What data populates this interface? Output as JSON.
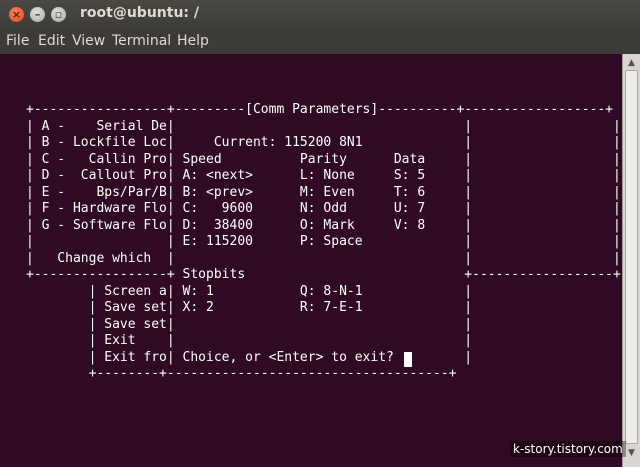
{
  "window": {
    "title": "root@ubuntu: /"
  },
  "menu": [
    "File",
    "Edit",
    "View",
    "Terminal",
    "Help"
  ],
  "terminal_lines": [
    "+-----------------+---------[Comm Parameters]----------+------------------+",
    "| A -    Serial De|                                     |                  |",
    "| B - Lockfile Loc|     Current: 115200 8N1             |                  |",
    "| C -   Callin Pro| Speed          Parity      Data     |                  |",
    "| D -  Callout Pro| A: <next>      L: None     S: 5     |                  |",
    "| E -    Bps/Par/B| B: <prev>      M: Even     T: 6     |                  |",
    "| F - Hardware Flo| C:   9600      N: Odd      U: 7     |                  |",
    "| G - Software Flo| D:  38400      O: Mark     V: 8     |                  |",
    "|                 | E: 115200      P: Space             |                  |",
    "|   Change which  |                                     |                  |",
    "+-----------------+ Stopbits                            +------------------+",
    "        | Screen a| W: 1           Q: 8-N-1             |",
    "        | Save set| X: 2           R: 7-E-1             |",
    "        | Save set|                                     |",
    "        | Exit    |                                     |",
    "        | Exit fro| Choice, or <Enter> to exit?         |",
    "        +--------+------------------------------------+"
  ],
  "watermark": "k-story.tistory.com",
  "colors": {
    "terminal_bg": "#300a24",
    "terminal_fg": "#ffffff",
    "titlebar_bg": "#3c3b37",
    "close_button": "#df4a16"
  },
  "icons": {
    "close": "close-icon",
    "minimize": "minimize-icon",
    "maximize": "maximize-icon"
  }
}
